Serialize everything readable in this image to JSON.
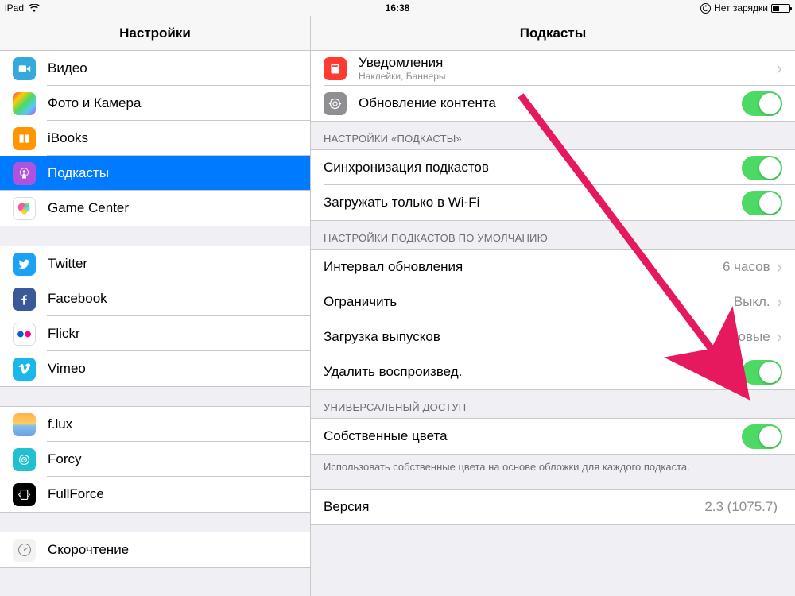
{
  "status": {
    "device": "iPad",
    "time": "16:38",
    "charging_text": "Нет зарядки"
  },
  "sidebar": {
    "title": "Настройки",
    "items": [
      {
        "id": "video",
        "label": "Видео"
      },
      {
        "id": "photos",
        "label": "Фото и Камера"
      },
      {
        "id": "ibooks",
        "label": "iBooks"
      },
      {
        "id": "podcasts",
        "label": "Подкасты",
        "selected": true
      },
      {
        "id": "gamecenter",
        "label": "Game Center"
      }
    ],
    "social": [
      {
        "id": "twitter",
        "label": "Twitter"
      },
      {
        "id": "facebook",
        "label": "Facebook"
      },
      {
        "id": "flickr",
        "label": "Flickr"
      },
      {
        "id": "vimeo",
        "label": "Vimeo"
      }
    ],
    "tweaks": [
      {
        "id": "flux",
        "label": "f.lux"
      },
      {
        "id": "forcy",
        "label": "Forcy"
      },
      {
        "id": "fullforce",
        "label": "FullForce"
      }
    ],
    "extra": [
      {
        "id": "speedread",
        "label": "Скорочтение"
      }
    ]
  },
  "detail": {
    "title": "Подкасты",
    "top_group": {
      "notifications": {
        "label": "Уведомления",
        "subtitle": "Наклейки, Баннеры"
      },
      "background": {
        "label": "Обновление контента",
        "on": true
      }
    },
    "podcast_settings": {
      "header": "НАСТРОЙКИ «ПОДКАСТЫ»",
      "sync": {
        "label": "Синхронизация подкастов",
        "on": true
      },
      "wifi_only": {
        "label": "Загружать только в Wi-Fi",
        "on": true
      }
    },
    "defaults": {
      "header": "НАСТРОЙКИ ПОДКАСТОВ ПО УМОЛЧАНИЮ",
      "interval": {
        "label": "Интервал обновления",
        "value": "6 часов"
      },
      "limit": {
        "label": "Ограничить",
        "value": "Выкл."
      },
      "download": {
        "label": "Загрузка выпусков",
        "value": "Новые"
      },
      "delete": {
        "label": "Удалить воспроизвед.",
        "on": true
      }
    },
    "accessibility": {
      "header": "УНИВЕРСАЛЬНЫЙ ДОСТУП",
      "own_colors": {
        "label": "Собственные цвета",
        "on": true
      },
      "footer": "Использовать собственные цвета на основе обложки для каждого подкаста."
    },
    "version": {
      "label": "Версия",
      "value": "2.3 (1075.7)"
    }
  },
  "annotation": {
    "color": "#e6195e"
  }
}
